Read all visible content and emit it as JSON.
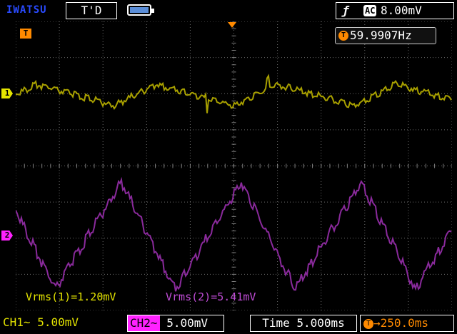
{
  "header": {
    "brand": "IWATSU",
    "trigger_mode": "T'D",
    "trigger_slope_icon": "rising-edge-icon",
    "trigger_coupling": "AC",
    "trigger_level": "8.00mV"
  },
  "markers": {
    "trigger_marker": "T",
    "ch1_marker": "1",
    "ch2_marker": "2"
  },
  "frequency": {
    "badge": "T",
    "value": "59.9907Hz"
  },
  "measurements": {
    "ch1": "Vrms(1)=1.20mV",
    "ch2": "Vrms(2)=5.41mV"
  },
  "footer": {
    "ch1_label": "CH1",
    "ch1_coupling": "~",
    "ch1_scale": "5.00mV",
    "ch2_label": "CH2",
    "ch2_coupling": "~",
    "ch2_scale": "5.00mV",
    "time_label": "Time",
    "time_scale": "5.000ms",
    "delay_badge": "T",
    "delay_value": "→250.0ms"
  },
  "colors": {
    "ch1": "#a8a000",
    "ch2": "#8a2a9c",
    "grid": "#9a9a9a",
    "accent": "#ff8a00"
  }
}
